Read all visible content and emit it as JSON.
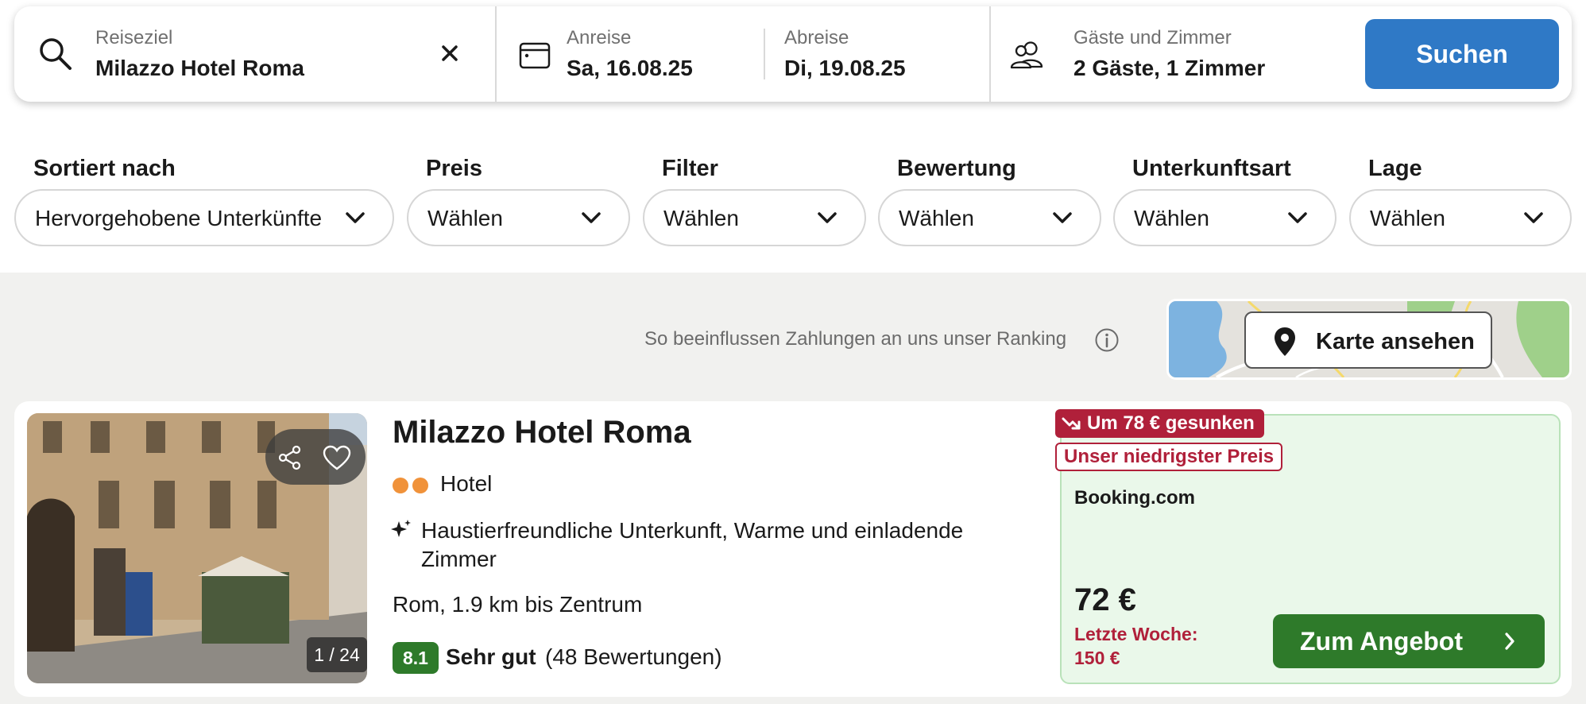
{
  "search": {
    "destination_label": "Reiseziel",
    "destination_value": "Milazzo Hotel Roma",
    "checkin_label": "Anreise",
    "checkin_value": "Sa, 16.08.25",
    "checkout_label": "Abreise",
    "checkout_value": "Di, 19.08.25",
    "guests_label": "Gäste und Zimmer",
    "guests_value": "2 Gäste, 1 Zimmer",
    "search_button": "Suchen",
    "icons": [
      "search-icon",
      "clear-icon",
      "calendar-icon",
      "guests-icon"
    ]
  },
  "filters": [
    {
      "label": "Sortiert nach",
      "value": "Hervorgehobene Unterkünfte"
    },
    {
      "label": "Preis",
      "value": "Wählen"
    },
    {
      "label": "Filter",
      "value": "Wählen"
    },
    {
      "label": "Bewertung",
      "value": "Wählen"
    },
    {
      "label": "Unterkunftsart",
      "value": "Wählen"
    },
    {
      "label": "Lage",
      "value": "Wählen"
    }
  ],
  "ranking_note": "So beeinflussen Zahlungen an uns unser Ranking",
  "map": {
    "button_label": "Karte ansehen",
    "icon": "map-pin-icon"
  },
  "result": {
    "name": "Milazzo Hotel Roma",
    "star_count": 2,
    "type": "Hotel",
    "highlights": "Haustierfreundliche Unterkunft, Warme und einladende Zimmer",
    "location": "Rom, 1.9 km bis Zentrum",
    "score": "8.1",
    "rating_word": "Sehr gut",
    "rating_count": "(48 Bewertungen)",
    "photo_counter": "1 / 24",
    "price_drop_badge": "Um 78 € gesunken",
    "lowest_price_badge": "Unser niedrigster Preis",
    "provider": "Booking.com",
    "price": "72 €",
    "last_week": "Letzte Woche: 150 €",
    "deal_button": "Zum Angebot"
  },
  "colors": {
    "accent_blue": "#2f79c6",
    "deal_green": "#2e7a2a",
    "price_red": "#b0203a",
    "star_orange": "#f0923a",
    "panel_green": "#eaf8ea"
  }
}
